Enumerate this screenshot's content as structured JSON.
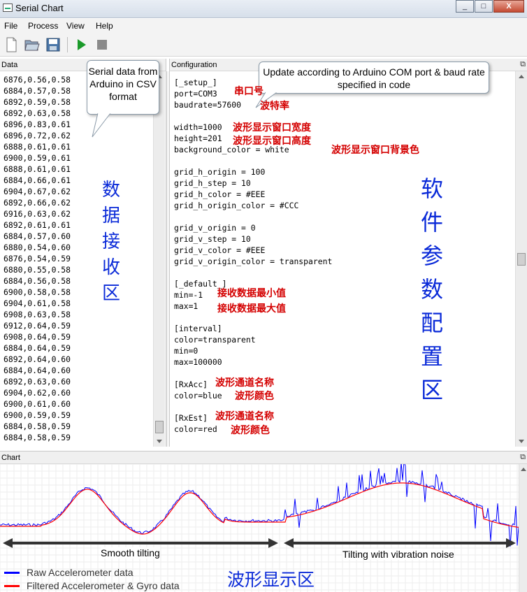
{
  "window": {
    "title": "Serial Chart",
    "buttons": [
      "_",
      "□",
      "X"
    ]
  },
  "menu": [
    "File",
    "Process",
    "View",
    "Help"
  ],
  "toolbar": {
    "icons": [
      "new-file-icon",
      "open-folder-icon",
      "save-disk-icon",
      "run-play-icon",
      "stop-square-icon"
    ]
  },
  "data_panel": {
    "header": "Data",
    "rows": [
      "6876,0.56,0.58",
      "6884,0.57,0.58",
      "6892,0.59,0.58",
      "6892,0.63,0.58",
      "6896,0.83,0.61",
      "6896,0.72,0.62",
      "6888,0.61,0.61",
      "6900,0.59,0.61",
      "6888,0.61,0.61",
      "6884,0.66,0.61",
      "6904,0.67,0.62",
      "6892,0.66,0.62",
      "6916,0.63,0.62",
      "6892,0.61,0.61",
      "6884,0.57,0.60",
      "6880,0.54,0.60",
      "6876,0.54,0.59",
      "6880,0.55,0.58",
      "6884,0.56,0.58",
      "6900,0.58,0.58",
      "6904,0.61,0.58",
      "6908,0.63,0.58",
      "6912,0.64,0.59",
      "6908,0.64,0.59",
      "6884,0.64,0.59",
      "6892,0.64,0.60",
      "6884,0.64,0.60",
      "6892,0.63,0.60",
      "6904,0.62,0.60",
      "6900,0.61,0.60",
      "6900,0.59,0.59",
      "6884,0.58,0.59",
      "6884,0.58,0.59"
    ],
    "callout": "Serial data from Arduino in CSV format",
    "zone_label": [
      "数",
      "据",
      "接",
      "收",
      "区"
    ]
  },
  "config_panel": {
    "header": "Configuration",
    "lines": [
      "[_setup_]",
      "port=COM3",
      "baudrate=57600",
      "",
      "width=1000",
      "height=201",
      "background_color = white",
      "",
      "grid_h_origin = 100",
      "grid_h_step = 10",
      "grid_h_color = #EEE",
      "grid_h_origin_color = #CCC",
      "",
      "grid_v_origin = 0",
      "grid_v_step = 10",
      "grid_v_color = #EEE",
      "grid_v_origin_color = transparent",
      "",
      "[_default_]",
      "min=-1",
      "max=1",
      "",
      "[interval]",
      "color=transparent",
      "min=0",
      "max=100000",
      "",
      "[RxAcc]",
      "color=blue",
      "",
      "[RxEst]",
      "color=red"
    ],
    "callout": "Update  according to Arduino COM port & baud rate specified in code",
    "annotations": {
      "port": "串口号",
      "baud": "波特率",
      "width": "波形显示窗口宽度",
      "height": "波形显示窗口高度",
      "bg": "波形显示窗口背景色",
      "min": "接收数据最小值",
      "max": "接收数据最大值",
      "rxacc_name": "波形通道名称",
      "rxacc_color": "波形颜色",
      "rxest_name": "波形通道名称",
      "rxest_color": "波形颜色"
    },
    "zone_label": [
      "软",
      "件",
      "参",
      "数",
      "配",
      "置",
      "区"
    ]
  },
  "chart_panel": {
    "header": "Chart",
    "smooth_label": "Smooth tilting",
    "noise_label": "Tilting with vibration noise",
    "zone_label": "波形显示区",
    "legend": [
      {
        "label": "Raw Accelerometer data",
        "color": "#0000ff"
      },
      {
        "label": "Filtered Accelerometer & Gyro data",
        "color": "#ff0000"
      }
    ]
  },
  "colors": {
    "raw": "#0000ff",
    "filtered": "#ff0000",
    "annotation_red": "#d40000",
    "zone_blue": "#0a2ad8"
  }
}
